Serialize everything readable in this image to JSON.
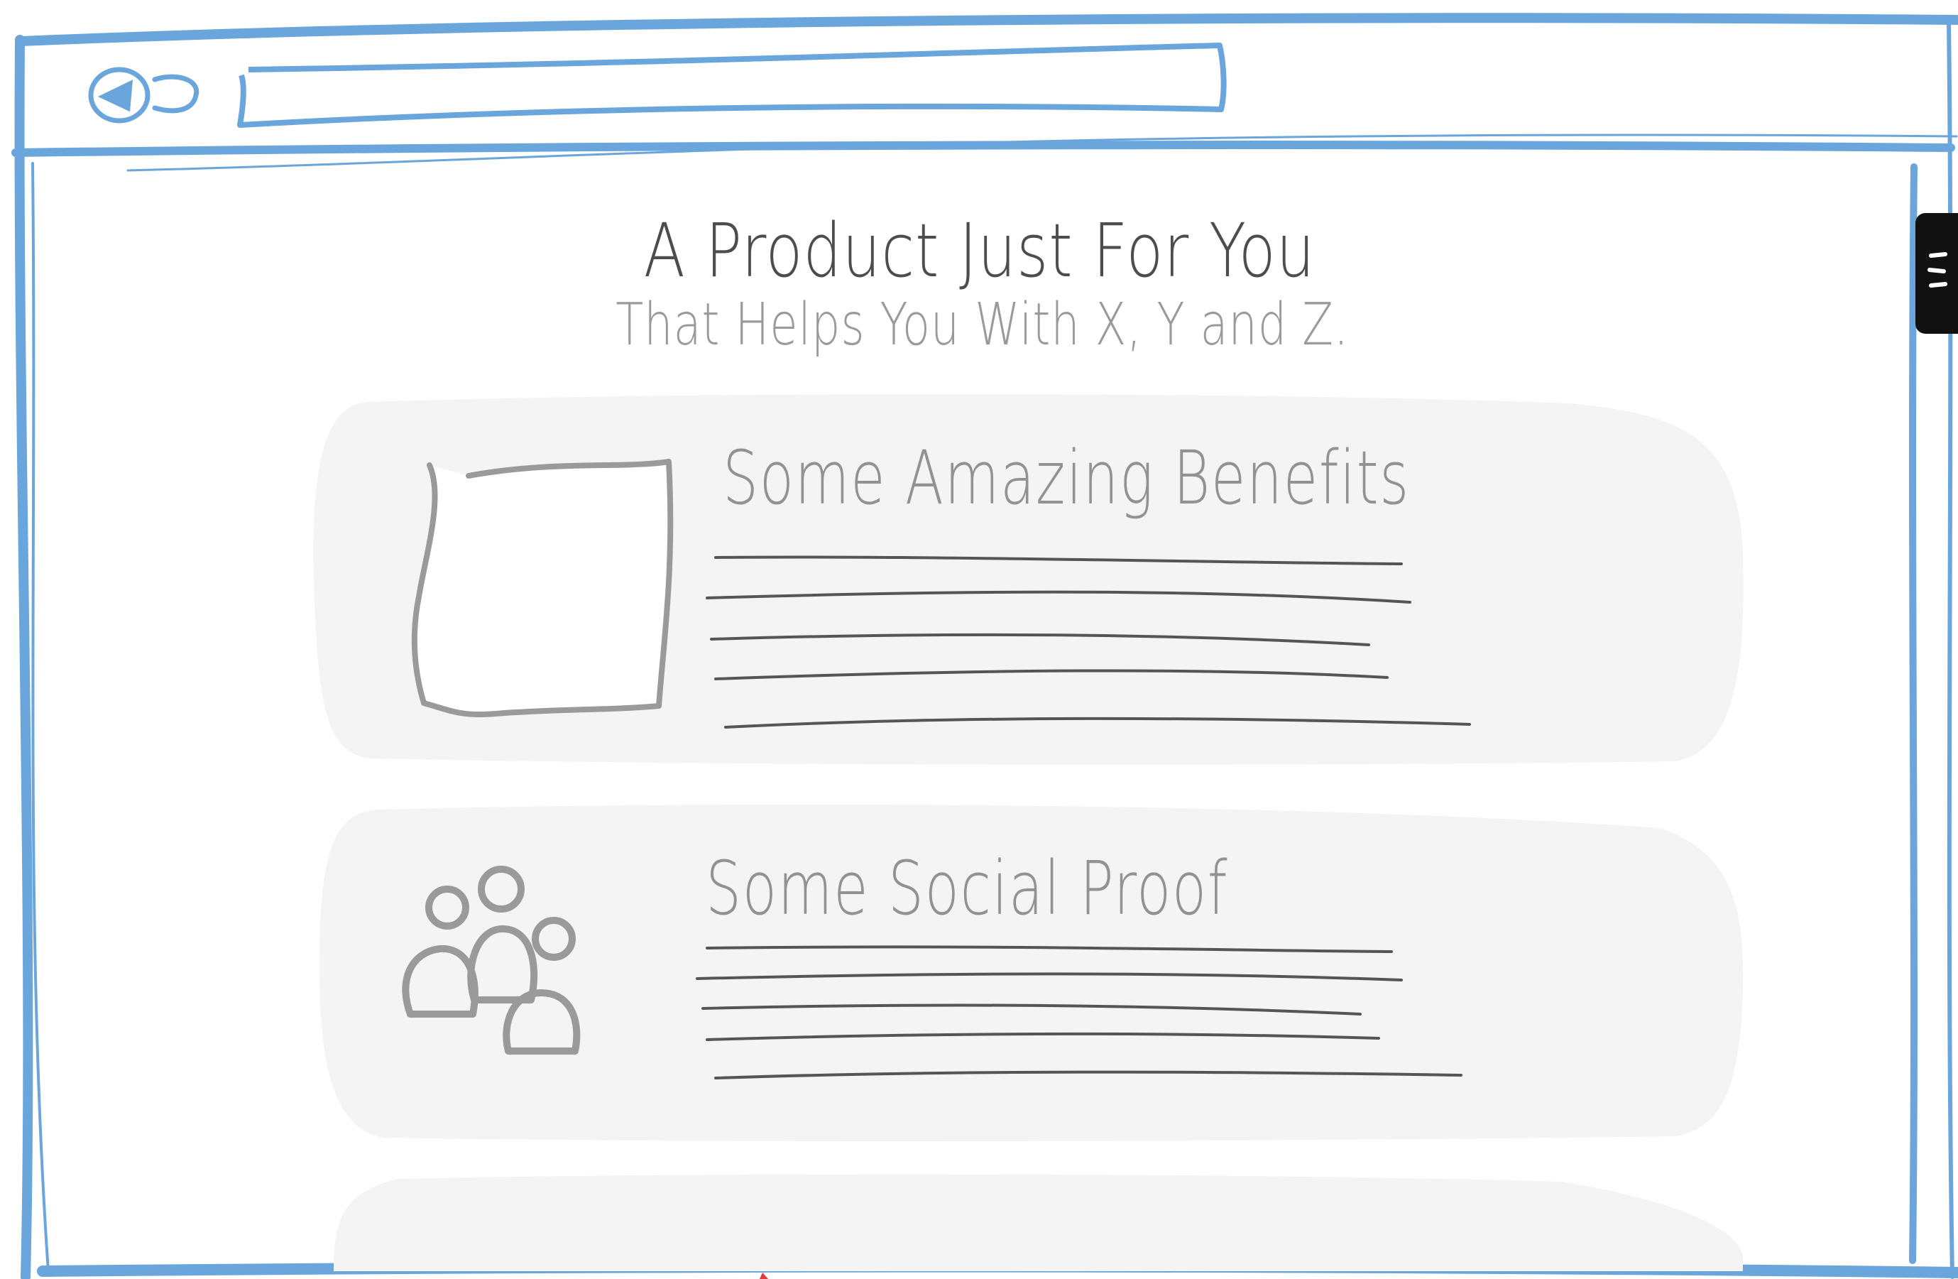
{
  "page": {
    "headline": "A Product Just For You",
    "subheadline": "That Helps You With X, Y and Z."
  },
  "cards": [
    {
      "title": "Some Amazing Benefits",
      "icon": "image-placeholder-icon"
    },
    {
      "title": "Some Social Proof",
      "icon": "users-group-icon"
    }
  ],
  "icons": {
    "back": "back-arrow-icon",
    "reload": "reload-icon",
    "menu": "hamburger-menu-icon"
  },
  "colors": {
    "frame": "#6aa6dc",
    "card_bg": "#f4f4f4",
    "sketch_gray": "#9a9a9a",
    "text_dark": "#4d4d4d",
    "line_dark": "#555555"
  }
}
